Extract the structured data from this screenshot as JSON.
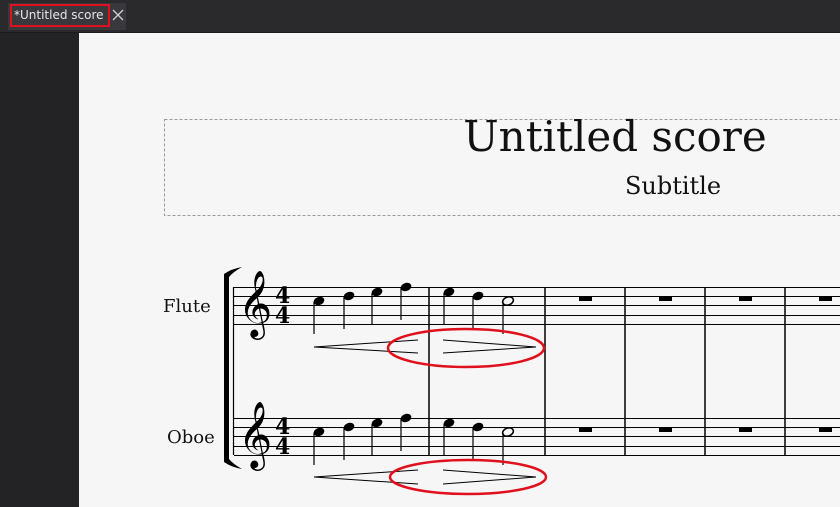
{
  "tab": {
    "label": "*Untitled score",
    "close_icon": "close-icon",
    "highlight_color": "#e0101c"
  },
  "score": {
    "title": "Untitled score",
    "subtitle": "Subtitle",
    "time_signature": {
      "numerator": "4",
      "denominator": "4"
    },
    "instruments": [
      "Flute",
      "Oboe"
    ],
    "annotation_color": "#e0101c",
    "measures_visible": [
      {
        "notes": [
          "C5 quarter",
          "D5 quarter",
          "E5 quarter",
          "F5 quarter"
        ],
        "hairpin": "crescendo"
      },
      {
        "notes": [
          "E5 quarter",
          "D5 quarter",
          "C5 half"
        ],
        "hairpin": "diminuendo",
        "highlighted": true
      },
      {
        "rest": "whole"
      },
      {
        "rest": "whole"
      },
      {
        "rest": "whole"
      },
      {
        "rest": "whole"
      }
    ]
  }
}
